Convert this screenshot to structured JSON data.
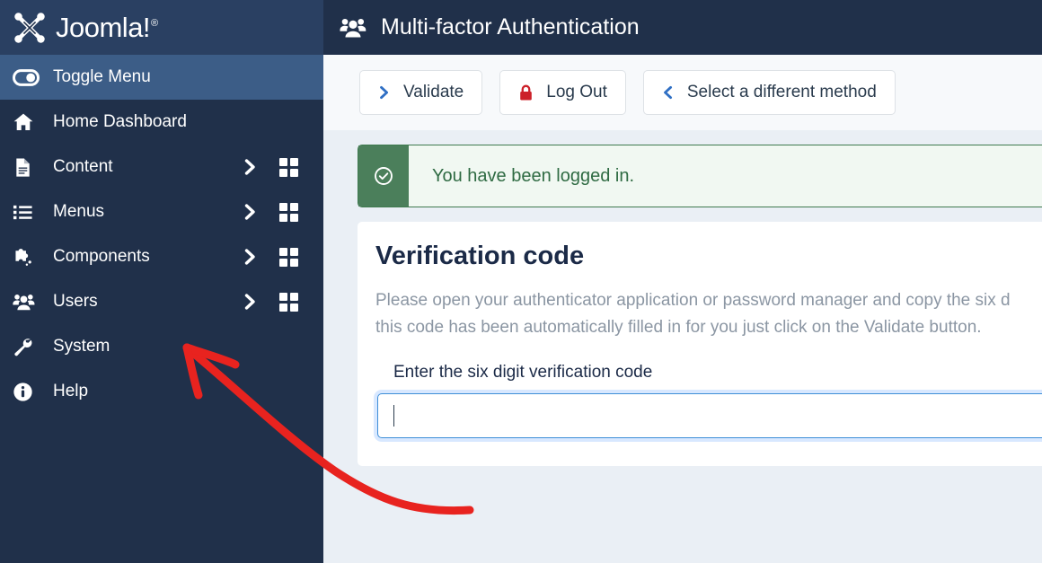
{
  "brand": {
    "name": "Joomla!",
    "registered_mark": "®",
    "logo_icon": "joomla-logo-icon"
  },
  "sidebar": {
    "toggle": {
      "label": "Toggle Menu",
      "icon": "toggle-switch-icon"
    },
    "items": [
      {
        "label": "Home Dashboard",
        "icon": "home-icon",
        "has_chevron": false,
        "has_grid": false
      },
      {
        "label": "Content",
        "icon": "document-icon",
        "has_chevron": true,
        "has_grid": true
      },
      {
        "label": "Menus",
        "icon": "list-icon",
        "has_chevron": true,
        "has_grid": true
      },
      {
        "label": "Components",
        "icon": "puzzle-icon",
        "has_chevron": true,
        "has_grid": true
      },
      {
        "label": "Users",
        "icon": "users-icon",
        "has_chevron": true,
        "has_grid": true
      },
      {
        "label": "System",
        "icon": "wrench-icon",
        "has_chevron": false,
        "has_grid": false
      },
      {
        "label": "Help",
        "icon": "info-circle-icon",
        "has_chevron": false,
        "has_grid": false
      }
    ]
  },
  "header": {
    "title": "Multi-factor Authentication",
    "icon": "users-icon"
  },
  "toolbar": {
    "buttons": [
      {
        "label": "Validate",
        "icon": "chevron-right-icon",
        "icon_color": "#2f6fc4"
      },
      {
        "label": "Log Out",
        "icon": "lock-icon",
        "icon_color": "#cc2029"
      },
      {
        "label": "Select a different method",
        "icon": "chevron-left-icon",
        "icon_color": "#2f6fc4"
      }
    ]
  },
  "alert": {
    "message": "You have been logged in.",
    "icon": "check-circle-icon",
    "type": "success",
    "accent_color": "#4b7f5b",
    "text_color": "#2f6b43"
  },
  "card": {
    "title": "Verification code",
    "description_line1": "Please open your authenticator application or password manager and copy the six d",
    "description_line2": "this code has been automatically filled in for you just click on the Validate button.",
    "field_label": "Enter the six digit verification code",
    "input_value": "",
    "input_placeholder": ""
  },
  "annotation": {
    "type": "hand-drawn-arrow",
    "color": "#e8231f",
    "points_to": "System"
  },
  "colors": {
    "sidebar_bg": "#20304a",
    "brand_bg": "#2a4062",
    "toggle_bg": "#3c5d87",
    "page_bg": "#eaeff5",
    "toolbar_bg": "#f7f9fb",
    "card_bg": "#ffffff",
    "focus_border": "#3f8fd8"
  }
}
